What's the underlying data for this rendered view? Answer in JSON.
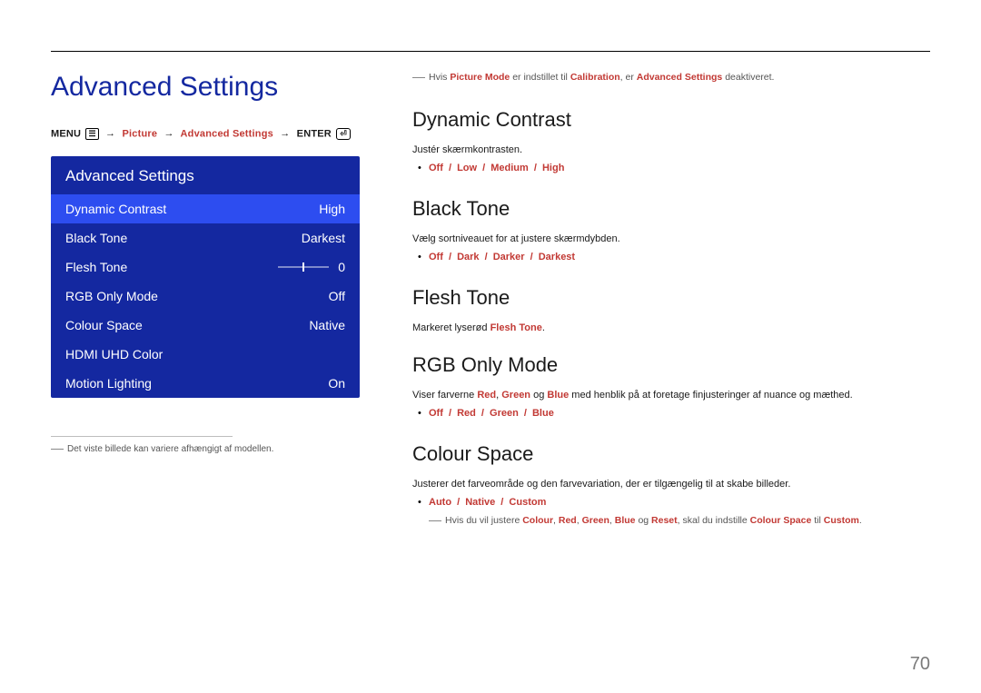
{
  "page_number": "70",
  "page_title": "Advanced Settings",
  "breadcrumb": {
    "menu": "MENU",
    "picture": "Picture",
    "advanced": "Advanced Settings",
    "enter": "ENTER"
  },
  "osd": {
    "header": "Advanced Settings",
    "rows": [
      {
        "label": "Dynamic Contrast",
        "value": "High",
        "selected": true
      },
      {
        "label": "Black Tone",
        "value": "Darkest"
      },
      {
        "label": "Flesh Tone",
        "value": "0",
        "slider": true
      },
      {
        "label": "RGB Only Mode",
        "value": "Off"
      },
      {
        "label": "Colour Space",
        "value": "Native"
      },
      {
        "label": "HDMI UHD Color",
        "value": ""
      },
      {
        "label": "Motion Lighting",
        "value": "On"
      }
    ]
  },
  "footnote_left": "Det viste billede kan variere afhængigt af modellen.",
  "top_note": {
    "t1": "Hvis ",
    "h1": "Picture Mode",
    "t2": " er indstillet til ",
    "h2": "Calibration",
    "t3": ", er ",
    "h3": "Advanced Settings",
    "t4": " deaktiveret."
  },
  "sections": {
    "dynamic_contrast": {
      "title": "Dynamic Contrast",
      "desc": "Justér skærmkontrasten.",
      "opts": [
        "Off",
        "Low",
        "Medium",
        "High"
      ]
    },
    "black_tone": {
      "title": "Black Tone",
      "desc": "Vælg sortniveauet for at justere skærmdybden.",
      "opts": [
        "Off",
        "Dark",
        "Darker",
        "Darkest"
      ]
    },
    "flesh_tone": {
      "title": "Flesh Tone",
      "desc_pre": "Markeret lyserød ",
      "desc_hl": "Flesh Tone",
      "desc_post": "."
    },
    "rgb_only": {
      "title": "RGB Only Mode",
      "desc_pre": "Viser farverne ",
      "r": "Red",
      "g": "Green",
      "b": "Blue",
      "desc_mid1": ", ",
      "desc_mid2": " og ",
      "desc_post": " med henblik på at foretage finjusteringer af nuance og mæthed.",
      "opts": [
        "Off",
        "Red",
        "Green",
        "Blue"
      ]
    },
    "colour_space": {
      "title": "Colour Space",
      "desc": "Justerer det farveområde og den farvevariation, der er tilgængelig til at skabe billeder.",
      "opts": [
        "Auto",
        "Native",
        "Custom"
      ],
      "note": {
        "t1": "Hvis du vil justere ",
        "h1": "Colour",
        "h2": "Red",
        "h3": "Green",
        "h4": "Blue",
        "h5": "Reset",
        "t2": ", ",
        "t3": " og ",
        "t4": ", skal du indstille ",
        "h6": "Colour Space",
        "t5": " til ",
        "h7": "Custom",
        "t6": "."
      }
    }
  }
}
